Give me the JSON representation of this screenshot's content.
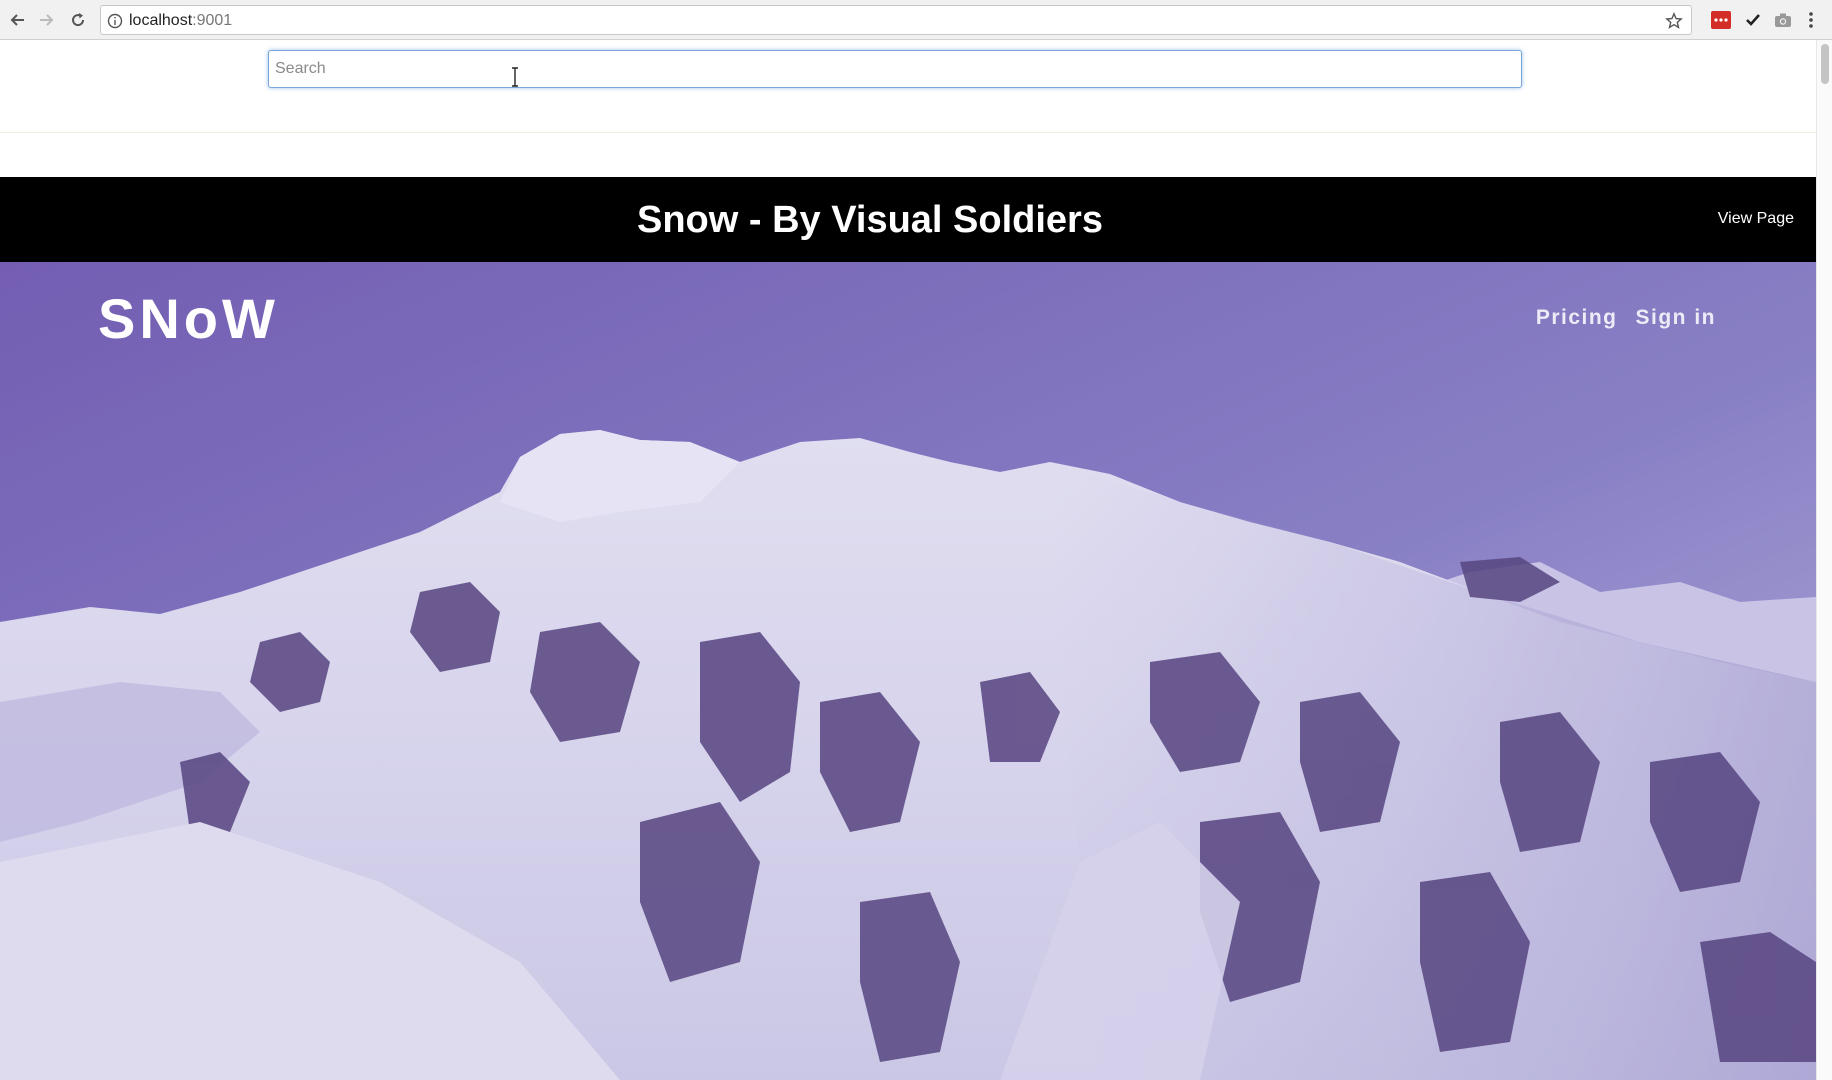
{
  "browser": {
    "url_host": "localhost",
    "url_port": ":9001",
    "icons": {
      "back": "arrow-left-icon",
      "forward": "arrow-right-icon",
      "reload": "reload-icon",
      "info": "info-icon",
      "bookmark": "star-icon",
      "extensions": [
        "lastpass-icon",
        "checkmark-icon",
        "camera-icon",
        "kebab-menu-icon"
      ]
    }
  },
  "search": {
    "placeholder": "Search",
    "value": ""
  },
  "title_bar": {
    "title": "Snow - By Visual Soldiers",
    "view_page_label": "View Page"
  },
  "hero": {
    "logo_text": "SNoW",
    "nav": [
      {
        "label": "Pricing"
      },
      {
        "label": "Sign in"
      }
    ]
  },
  "colors": {
    "title_bar_bg": "#000000",
    "hero_sky_top": "#7a64b6",
    "hero_sky_bottom": "#b8b4e0",
    "snow": "#e8e8f6",
    "rock": "#4e3d72"
  }
}
